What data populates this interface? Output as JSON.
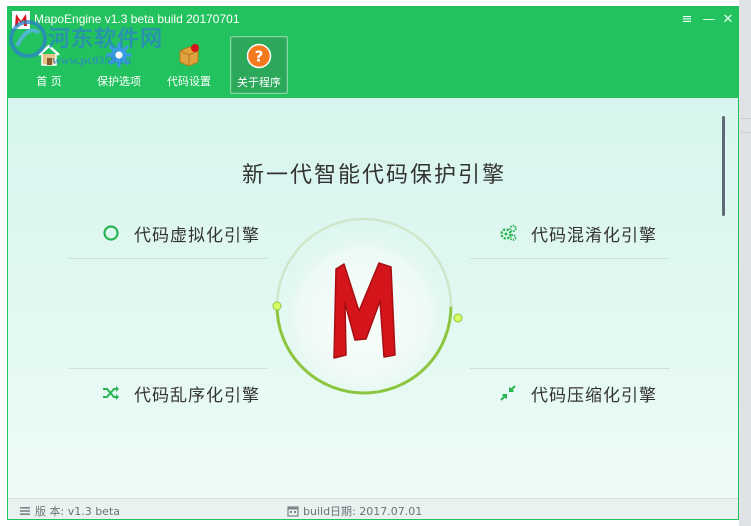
{
  "window": {
    "title": "MapoEngine v1.3 beta build 20170701",
    "controls": {
      "menu": "≡",
      "minimize": "—",
      "close": "✕"
    }
  },
  "watermark": {
    "text": "河东软件网",
    "url": "www.pc0359.cn"
  },
  "toolbar": {
    "items": [
      {
        "label": "首  页",
        "icon": "home-icon",
        "active": false
      },
      {
        "label": "保护选项",
        "icon": "gear-icon",
        "active": false
      },
      {
        "label": "代码设置",
        "icon": "box-icon",
        "active": false
      },
      {
        "label": "关于程序",
        "icon": "question-icon",
        "active": true
      }
    ]
  },
  "main": {
    "headline": "新一代智能代码保护引擎",
    "features": [
      {
        "label": "代码虚拟化引擎",
        "icon": "circle-icon"
      },
      {
        "label": "代码混淆化引擎",
        "icon": "gears-icon"
      },
      {
        "label": "代码乱序化引擎",
        "icon": "shuffle-icon"
      },
      {
        "label": "代码压缩化引擎",
        "icon": "compress-icon"
      }
    ],
    "logo_letter": "M"
  },
  "status": {
    "version": "版 本: v1.3 beta",
    "build_date": "build日期: 2017.07.01"
  },
  "colors": {
    "title_green": "#22c25e",
    "accent_green": "#2ab553",
    "logo_red": "#d4161c",
    "ring_green": "#8cc63f",
    "question_orange": "#f47a20"
  }
}
